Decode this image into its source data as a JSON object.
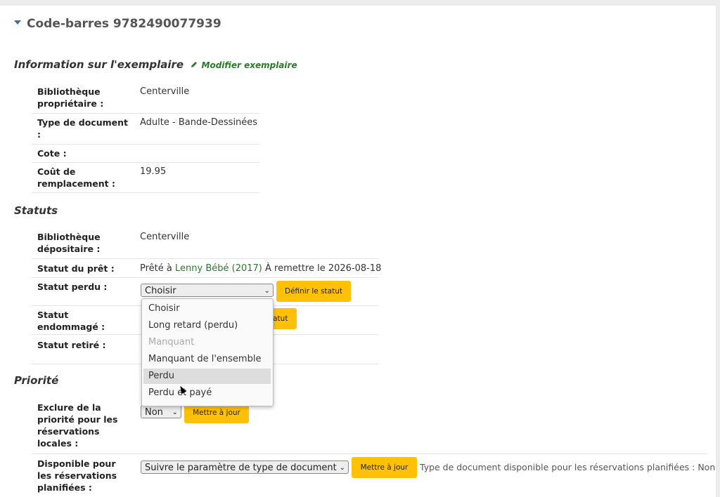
{
  "heading": "Code-barres 9782490077939",
  "info": {
    "title": "Information sur l'exemplaire",
    "edit_link": "Modifier exemplaire",
    "rows": [
      {
        "label": "Bibliothèque propriétaire :",
        "value": "Centerville"
      },
      {
        "label": "Type de document :",
        "value": "Adulte - Bande-Dessinées"
      },
      {
        "label": "Cote :",
        "value": ""
      },
      {
        "label": "Coût de remplacement :",
        "value": "19.95"
      }
    ]
  },
  "statuts": {
    "title": "Statuts",
    "holding_label": "Bibliothèque dépositaire :",
    "holding_value": "Centerville",
    "loan_label": "Statut du prêt :",
    "loan_prefix": "Prêté à",
    "loan_patron": "Lenny Bébé (2017)",
    "loan_suffix": "À remettre le 2026-08-18",
    "lost_label": "Statut perdu :",
    "lost_selected": "Choisir",
    "lost_button": "Définir le statut",
    "damaged_label": "Statut endommagé :",
    "damaged_button_partial": "tatut",
    "withdrawn_label": "Statut retiré :",
    "lost_options": [
      {
        "label": "Choisir",
        "disabled": false,
        "highlighted": false
      },
      {
        "label": "Long retard (perdu)",
        "disabled": false,
        "highlighted": false
      },
      {
        "label": "Manquant",
        "disabled": true,
        "highlighted": false
      },
      {
        "label": "Manquant de l'ensemble",
        "disabled": false,
        "highlighted": false
      },
      {
        "label": "Perdu",
        "disabled": false,
        "highlighted": true
      },
      {
        "label": "Perdu et payé",
        "disabled": false,
        "highlighted": false
      }
    ]
  },
  "priorite": {
    "title": "Priorité",
    "exclude_label": "Exclure de la priorité pour les réservations locales :",
    "exclude_value": "Non",
    "exclude_button": "Mettre à jour",
    "available_label": "Disponible pour les réservations planifiées :",
    "available_value": "Suivre le paramètre de type de document",
    "available_button": "Mettre à jour",
    "available_note": "Type de document disponible pour les réservations planifiées : Non"
  },
  "colors": {
    "accent": "#ffc107",
    "link": "#2a7a2a",
    "caret": "#3a6ea5"
  }
}
